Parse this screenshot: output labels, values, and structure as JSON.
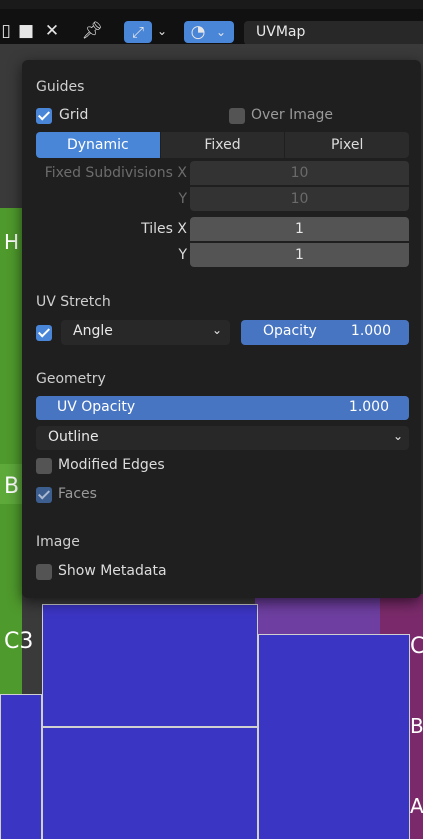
{
  "header": {
    "icons": [
      "image-icon",
      "close-icon",
      "pin-icon",
      "transform-icon",
      "chevron-down-icon",
      "overlay-icon",
      "chevron-down-icon"
    ],
    "uvmap_field": "UVMap"
  },
  "popover": {
    "guides": {
      "title": "Guides",
      "grid_label": "Grid",
      "grid_checked": true,
      "over_image_label": "Over Image",
      "over_image_checked": false,
      "segments": [
        "Dynamic",
        "Fixed",
        "Pixel"
      ],
      "active_segment": "Dynamic",
      "fixed_subdivisions_label": "Fixed Subdivisions X",
      "fixed_subdivisions_x": "10",
      "fixed_y_label": "Y",
      "fixed_subdivisions_y": "10",
      "tiles_x_label": "Tiles X",
      "tiles_x": "1",
      "tiles_y_label": "Y",
      "tiles_y": "1"
    },
    "uv_stretch": {
      "title": "UV Stretch",
      "enabled": true,
      "mode": "Angle",
      "opacity_label": "Opacity",
      "opacity_value": "1.000"
    },
    "geometry": {
      "title": "Geometry",
      "uv_opacity_label": "UV Opacity",
      "uv_opacity_value": "1.000",
      "display_mode": "Outline",
      "modified_edges_label": "Modified Edges",
      "modified_edges_checked": false,
      "faces_label": "Faces",
      "faces_checked": true
    },
    "image": {
      "title": "Image",
      "show_metadata_label": "Show Metadata",
      "show_metadata_checked": false
    }
  },
  "viewport": {
    "side_letters": [
      "H",
      "B",
      "C3",
      "C",
      "B",
      "A"
    ]
  },
  "colors": {
    "accent": "#4a86d8",
    "uv_face": "#3b35c4",
    "texture_green": "#4f9a2c",
    "texture_purple": "#7a2a6a",
    "panel_bg": "#1f1f1f"
  }
}
